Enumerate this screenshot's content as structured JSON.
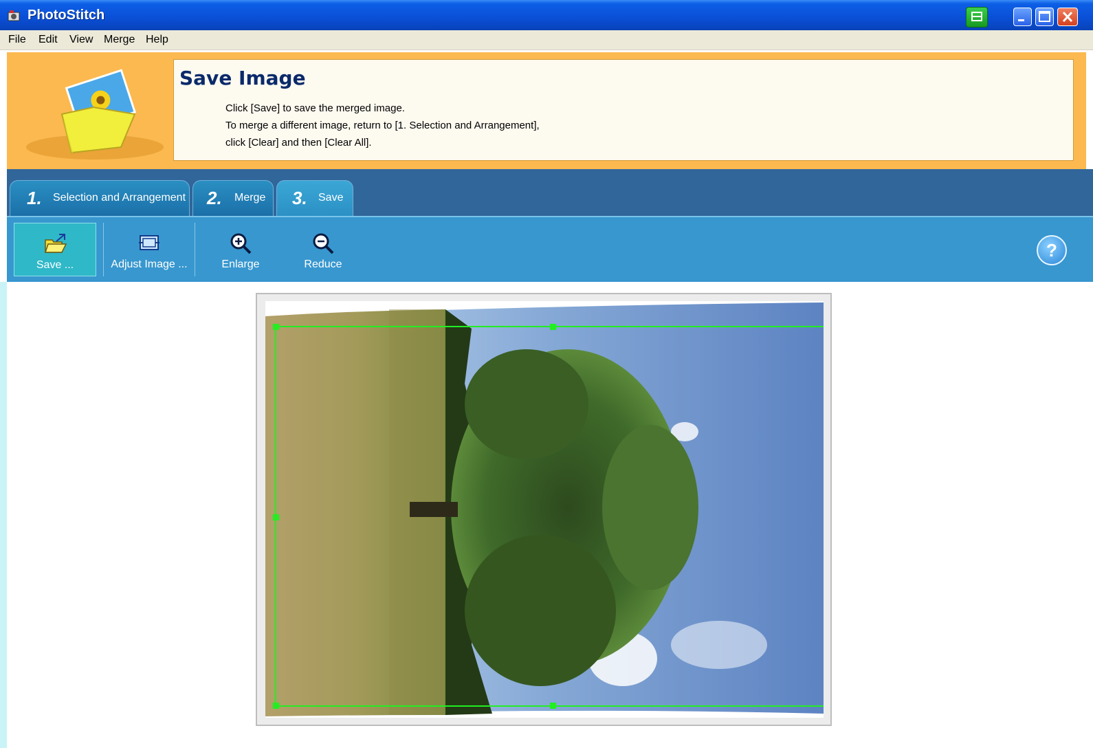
{
  "window": {
    "title": "PhotoStitch"
  },
  "menu": [
    "File",
    "Edit",
    "View",
    "Merge",
    "Help"
  ],
  "header": {
    "title": "Save Image",
    "lines": [
      "Click [Save] to save the merged image.",
      "To merge a different image, return to [1. Selection and Arrangement],",
      "click [Clear] and then [Clear All]."
    ]
  },
  "tabs": [
    {
      "num": "1.",
      "label": "Selection and Arrangement"
    },
    {
      "num": "2.",
      "label": "Merge"
    },
    {
      "num": "3.",
      "label": "Save"
    }
  ],
  "toolbar": {
    "save": "Save ...",
    "adjust": "Adjust Image ...",
    "enlarge": "Enlarge",
    "reduce": "Reduce",
    "help": "?"
  },
  "icons": {
    "app": "app-icon",
    "save": "folder-open-icon",
    "adjust": "adjust-image-icon",
    "enlarge": "zoom-in-icon",
    "reduce": "zoom-out-icon",
    "help": "help-icon"
  },
  "colors": {
    "titlebar": "#0a4fd6",
    "header_bg": "#fbb94f",
    "tabbar": "#31669a",
    "toolbar": "#3897cf",
    "crop_border": "#22ee22"
  }
}
